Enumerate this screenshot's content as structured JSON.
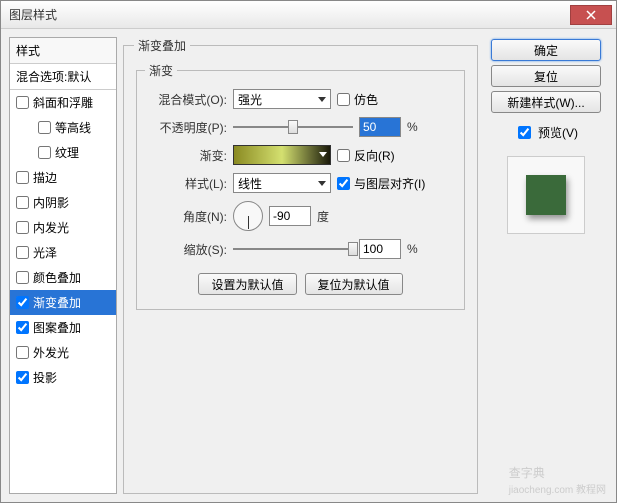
{
  "window": {
    "title": "图层样式"
  },
  "styles": {
    "header": "样式",
    "blend_defaults": "混合选项:默认",
    "items": [
      {
        "label": "斜面和浮雕",
        "checked": false,
        "indent": false
      },
      {
        "label": "等高线",
        "checked": false,
        "indent": true
      },
      {
        "label": "纹理",
        "checked": false,
        "indent": true
      },
      {
        "label": "描边",
        "checked": false,
        "indent": false
      },
      {
        "label": "内阴影",
        "checked": false,
        "indent": false
      },
      {
        "label": "内发光",
        "checked": false,
        "indent": false
      },
      {
        "label": "光泽",
        "checked": false,
        "indent": false
      },
      {
        "label": "颜色叠加",
        "checked": false,
        "indent": false
      },
      {
        "label": "渐变叠加",
        "checked": true,
        "indent": false,
        "selected": true
      },
      {
        "label": "图案叠加",
        "checked": true,
        "indent": false
      },
      {
        "label": "外发光",
        "checked": false,
        "indent": false
      },
      {
        "label": "投影",
        "checked": true,
        "indent": false
      }
    ]
  },
  "panel": {
    "title": "渐变叠加",
    "group": "渐变",
    "blend_mode_label": "混合模式(O):",
    "blend_mode_value": "强光",
    "dither": "仿色",
    "opacity_label": "不透明度(P):",
    "opacity_value": "50",
    "opacity_unit": "%",
    "gradient_label": "渐变:",
    "reverse": "反向(R)",
    "style_label": "样式(L):",
    "style_value": "线性",
    "align": "与图层对齐(I)",
    "angle_label": "角度(N):",
    "angle_value": "-90",
    "angle_unit": "度",
    "scale_label": "缩放(S):",
    "scale_value": "100",
    "scale_unit": "%",
    "set_default": "设置为默认值",
    "reset_default": "复位为默认值"
  },
  "buttons": {
    "ok": "确定",
    "cancel": "复位",
    "new_style": "新建样式(W)...",
    "preview": "预览(V)"
  },
  "watermark": {
    "main": "查字典",
    "sub": "jiaocheng.com 教程网"
  }
}
